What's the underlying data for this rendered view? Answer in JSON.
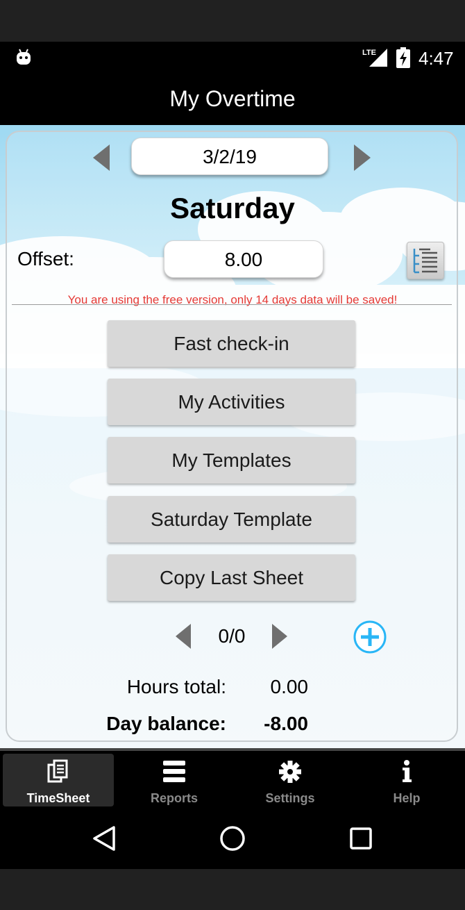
{
  "status_bar": {
    "network": "LTE",
    "time": "4:47",
    "icons": [
      "android-icon",
      "lte-signal-icon",
      "battery-charging-icon"
    ]
  },
  "app_bar": {
    "title": "My Overtime"
  },
  "day_header": {
    "date": "3/2/19",
    "weekday": "Saturday",
    "offset_label": "Offset:",
    "offset_value": "8.00",
    "free_version_note": "You are using the free version, only 14 days data will be saved!"
  },
  "actions": [
    {
      "label": "Fast check-in"
    },
    {
      "label": "My Activities"
    },
    {
      "label": "My Templates"
    },
    {
      "label": "Saturday Template"
    },
    {
      "label": "Copy Last Sheet"
    }
  ],
  "pager": {
    "count": "0/0"
  },
  "totals": {
    "hours_total_label": "Hours total:",
    "hours_total_value": "0.00",
    "day_balance_label": "Day balance:",
    "day_balance_value": "-8.00"
  },
  "tabs": [
    {
      "label": "TimeSheet",
      "icon": "timesheet-icon",
      "active": true
    },
    {
      "label": "Reports",
      "icon": "list-icon",
      "active": false
    },
    {
      "label": "Settings",
      "icon": "gear-icon",
      "active": false
    },
    {
      "label": "Help",
      "icon": "info-icon",
      "active": false
    }
  ],
  "colors": {
    "warning_text": "#e53935",
    "add_button": "#29b6f6",
    "button_bg": "#d8d8d8"
  }
}
